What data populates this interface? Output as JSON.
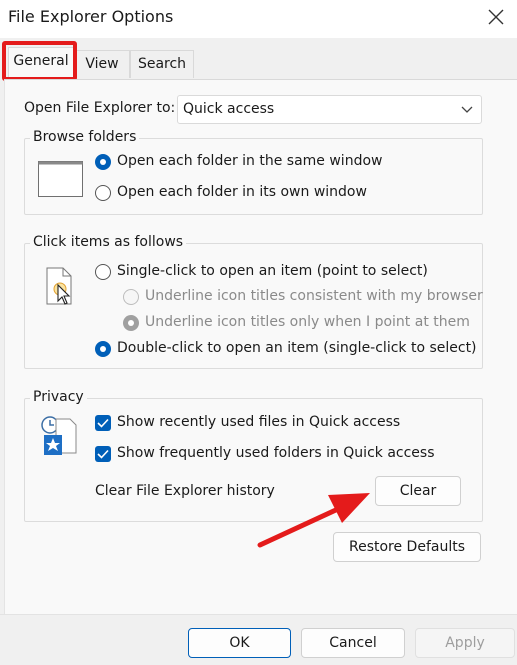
{
  "window": {
    "title": "File Explorer Options",
    "close_icon": "close-icon"
  },
  "tabs": [
    {
      "label": "General",
      "active": true
    },
    {
      "label": "View",
      "active": false
    },
    {
      "label": "Search",
      "active": false
    }
  ],
  "open_to": {
    "label": "Open File Explorer to:",
    "value": "Quick access"
  },
  "browse_folders": {
    "title": "Browse folders",
    "options": [
      {
        "label": "Open each folder in the same window",
        "checked": true
      },
      {
        "label": "Open each folder in its own window",
        "checked": false
      }
    ]
  },
  "click_items": {
    "title": "Click items as follows",
    "options": [
      {
        "label": "Single-click to open an item (point to select)",
        "checked": false
      },
      {
        "label": "Underline icon titles consistent with my browser",
        "checked": false,
        "disabled": true
      },
      {
        "label": "Underline icon titles only when I point at them",
        "checked": true,
        "disabled": true
      },
      {
        "label": "Double-click to open an item (single-click to select)",
        "checked": true
      }
    ]
  },
  "privacy": {
    "title": "Privacy",
    "checks": [
      {
        "label": "Show recently used files in Quick access",
        "checked": true
      },
      {
        "label": "Show frequently used folders in Quick access",
        "checked": true
      }
    ],
    "history_label": "Clear File Explorer history",
    "clear_label": "Clear"
  },
  "restore_label": "Restore Defaults",
  "footer": {
    "ok": "OK",
    "cancel": "Cancel",
    "apply": "Apply"
  },
  "colors": {
    "accent": "#005fb8",
    "highlight": "#e41b1b"
  }
}
